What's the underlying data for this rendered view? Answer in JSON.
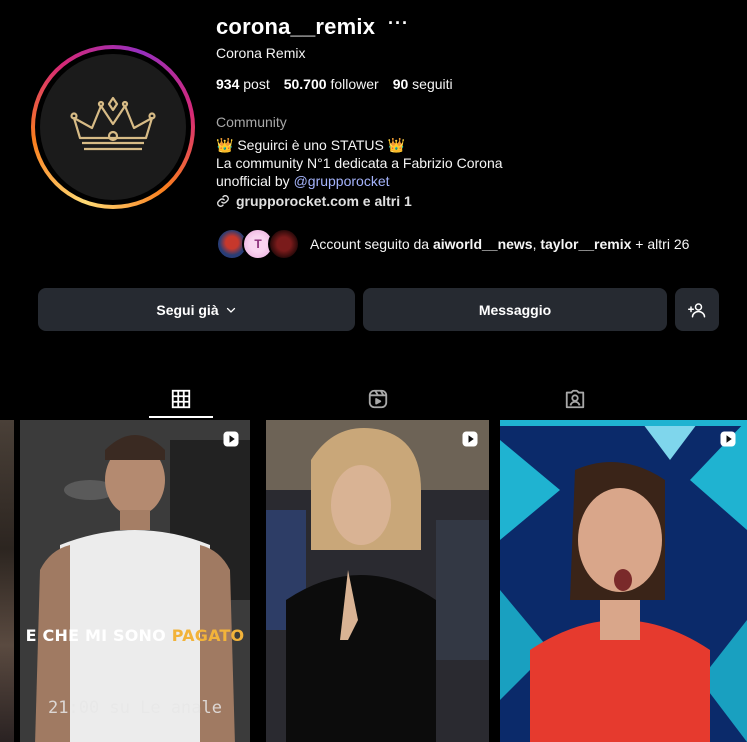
{
  "profile": {
    "username": "corona__remix",
    "more": "···",
    "full_name": "Corona Remix",
    "stats": {
      "posts_value": "934",
      "posts_label": "post",
      "followers_value": "50.700",
      "followers_label": "follower",
      "following_value": "90",
      "following_label": "seguiti"
    },
    "category": "Community",
    "bio": {
      "line1_text": "Seguirci è uno STATUS",
      "line1_emoji": "👑",
      "line2": "La community N°1 dedicata a Fabrizio Corona",
      "line3_prefix": "unofficial by ",
      "line3_mention": "@grupporocket"
    },
    "link": "grupporocket.com e altri 1",
    "followed_by": {
      "prefix": "Account seguito da ",
      "user1": "aiworld__news",
      "sep": ", ",
      "user2": "taylor__remix",
      "suffix": " + altri 26",
      "avatar2_letter": "T"
    }
  },
  "buttons": {
    "follow": "Segui già",
    "message": "Messaggio"
  },
  "tabs": [
    "grid-icon",
    "reels-icon",
    "tagged-icon"
  ],
  "posts": [
    {
      "caption_plain": "E CHE MI SONO ",
      "caption_highlight": "PAGATO",
      "timestamp": "21:00 su Le  anale"
    },
    {},
    {}
  ],
  "colors": {
    "background": "#000000",
    "button": "#262a31",
    "mention": "#a5b4fc",
    "muted": "#a8a8a8",
    "caption_highlight": "#f2b33a"
  }
}
